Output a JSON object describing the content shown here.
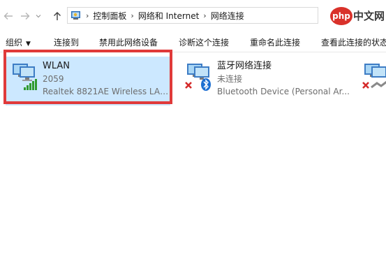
{
  "address": {
    "crumbs": [
      "控制面板",
      "网络和 Internet",
      "网络连接"
    ]
  },
  "watermark": {
    "text_left": "php",
    "text_right": "中文网"
  },
  "toolbar": {
    "organize_label": "组织",
    "connect_label": "连接到",
    "disable_label": "禁用此网络设备",
    "diagnose_label": "诊断这个连接",
    "rename_label": "重命名此连接",
    "status_label": "查看此连接的状态"
  },
  "connections": [
    {
      "name": "WLAN",
      "status": "2059",
      "device": "Realtek 8821AE Wireless LAN ...",
      "icon": "wifi-network-icon"
    },
    {
      "name": "蓝牙网络连接",
      "status": "未连接",
      "device": "Bluetooth Device (Personal Ar...",
      "icon": "bluetooth-network-icon"
    },
    {
      "name": "",
      "status": "",
      "device": "",
      "icon": "ethernet-network-icon"
    }
  ],
  "colors": {
    "selection": "#cce8ff",
    "highlight_border": "#e03a3a",
    "watermark_bg": "#d9312a"
  }
}
